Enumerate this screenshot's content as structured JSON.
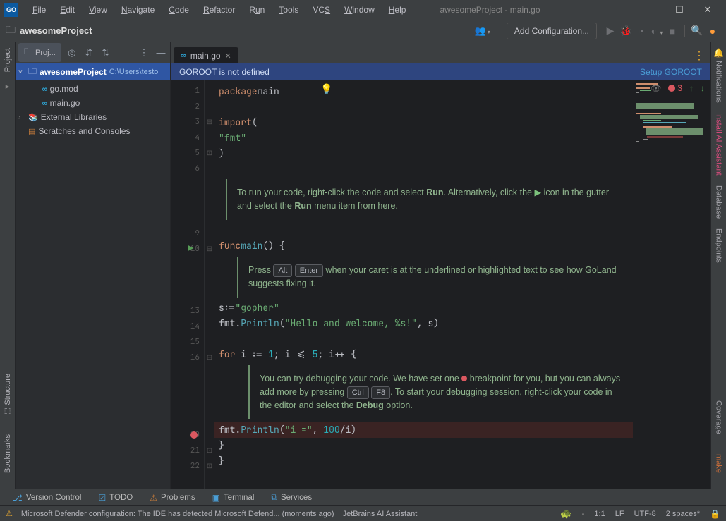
{
  "titlebar": {
    "app_abbrev": "GO",
    "menu": [
      "File",
      "Edit",
      "View",
      "Navigate",
      "Code",
      "Refactor",
      "Run",
      "Tools",
      "VCS",
      "Window",
      "Help"
    ],
    "title": "awesomeProject - main.go"
  },
  "toolbar": {
    "project_name": "awesomeProject",
    "config_label": "Add Configuration..."
  },
  "left_rail": {
    "tabs": [
      "Project"
    ],
    "bottom": [
      "Structure",
      "Bookmarks"
    ]
  },
  "project_tree": {
    "tab_label": "Proj...",
    "root_name": "awesomeProject",
    "root_path": "C:\\Users\\testo",
    "children": [
      "go.mod",
      "main.go"
    ],
    "ext_lib": "External Libraries",
    "scratches": "Scratches and Consoles"
  },
  "file_tab": {
    "name": "main.go"
  },
  "banner": {
    "msg": "GOROOT is not defined",
    "action": "Setup GOROOT"
  },
  "editor_status": {
    "error_count": "3"
  },
  "code": {
    "l1_kw": "package",
    "l1_id": "main",
    "l3_kw": "import",
    "l3_p": "(",
    "l4_str": "\"fmt\"",
    "l5_p": ")",
    "l10_kw": "func",
    "l10_id": "main",
    "l10_rest": "() {",
    "l13": "s := ",
    "l13_str": "\"gopher\"",
    "l14a": "fmt",
    "l14b": ".",
    "l14c": "Println",
    "l14d": "(",
    "l14e": "\"Hello and welcome, %s!\"",
    "l14f": ", s)",
    "l16_kw": "for",
    "l16_rest": " i := ",
    "l16_n1": "1",
    "l16_m": "; i <= ",
    "l16_n5": "5",
    "l16_end": "; i++ {",
    "l20a": "fmt",
    "l20b": ".",
    "l20c": "Println",
    "l20d": "(",
    "l20e": "\"i =\"",
    "l20f": ", ",
    "l20n": "100",
    "l20g": "/i)",
    "l21": "}",
    "l22": "}"
  },
  "line_numbers": [
    1,
    2,
    "",
    3,
    4,
    5,
    6,
    "",
    "",
    "",
    "",
    9,
    10,
    "",
    "",
    "",
    13,
    14,
    15,
    16,
    "",
    "",
    "",
    "",
    20,
    21,
    22
  ],
  "hints": {
    "h1a": "To run your code, right-click the code and select ",
    "h1b": "Run",
    "h1c": ". Alternatively, click the ",
    "h1d": " icon in the gutter and select the ",
    "h1e": "Run",
    "h1f": " menu item from here.",
    "h2a": "Press ",
    "h2_k1": "Alt",
    "h2_k2": "Enter",
    "h2b": " when your caret is at the underlined or highlighted text to see how GoLand suggests fixing it.",
    "h3a": "You can try debugging your code. We have set one ",
    "h3b": " breakpoint for you, but you can always add more by pressing ",
    "h3_k1": "Ctrl",
    "h3_k2": "F8",
    "h3c": ". To start your debugging session, right-click your code in the editor and select the ",
    "h3d": "Debug",
    "h3e": " option."
  },
  "right_rail": {
    "tabs": [
      "Notifications",
      "Install AI Assistant",
      "Database",
      "Endpoints"
    ],
    "bottom": [
      "Coverage",
      "make"
    ]
  },
  "bottom_tabs": {
    "items": [
      "Version Control",
      "TODO",
      "Problems",
      "Terminal",
      "Services"
    ]
  },
  "statusbar": {
    "msg": "Microsoft Defender configuration: The IDE has detected Microsoft Defend... (moments ago)",
    "ai": "JetBrains AI Assistant",
    "pos": "1:1",
    "eol": "LF",
    "enc": "UTF-8",
    "indent": "2 spaces*"
  }
}
